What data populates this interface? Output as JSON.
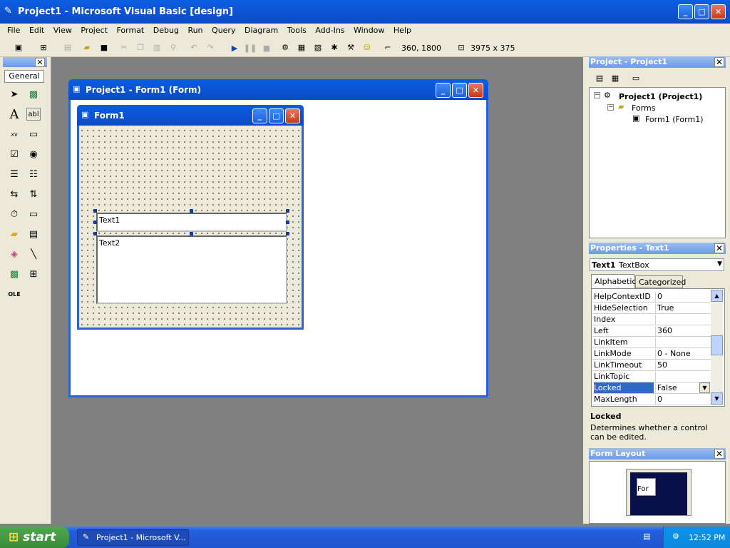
{
  "window": {
    "title": "Project1 - Microsoft Visual Basic [design]"
  },
  "menu": [
    "File",
    "Edit",
    "View",
    "Project",
    "Format",
    "Debug",
    "Run",
    "Query",
    "Diagram",
    "Tools",
    "Add-Ins",
    "Window",
    "Help"
  ],
  "toolbar": {
    "position": "360, 1800",
    "size": "3975 x 375"
  },
  "toolbox": {
    "tab": "General"
  },
  "designer": {
    "title": "Project1 - Form1 (Form)",
    "form_title": "Form1",
    "text1": "Text1",
    "text2": "Text2"
  },
  "project_explorer": {
    "title": "Project - Project1",
    "root": "Project1 (Project1)",
    "folder": "Forms",
    "item": "Form1 (Form1)"
  },
  "properties": {
    "title": "Properties - Text1",
    "object_name": "Text1",
    "object_type": "TextBox",
    "tab_alpha": "Alphabetic",
    "tab_cat": "Categorized",
    "rows": [
      {
        "name": "HelpContextID",
        "value": "0"
      },
      {
        "name": "HideSelection",
        "value": "True"
      },
      {
        "name": "Index",
        "value": ""
      },
      {
        "name": "Left",
        "value": "360"
      },
      {
        "name": "LinkItem",
        "value": ""
      },
      {
        "name": "LinkMode",
        "value": "0 - None"
      },
      {
        "name": "LinkTimeout",
        "value": "50"
      },
      {
        "name": "LinkTopic",
        "value": ""
      },
      {
        "name": "Locked",
        "value": "False"
      },
      {
        "name": "MaxLength",
        "value": "0"
      }
    ],
    "desc_title": "Locked",
    "desc_text": "Determines whether a control can be edited."
  },
  "form_layout": {
    "title": "Form Layout",
    "preview": "For"
  },
  "taskbar": {
    "start": "start",
    "task": "Project1 - Microsoft V...",
    "clock": "12:52 PM"
  }
}
